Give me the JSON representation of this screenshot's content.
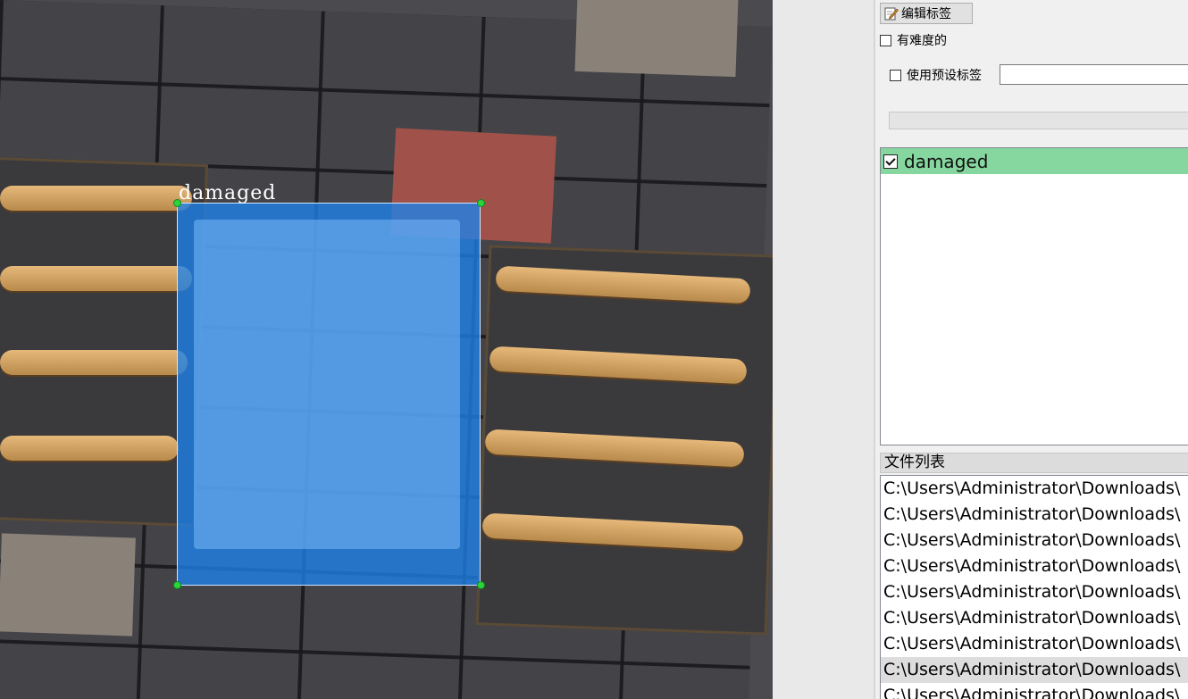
{
  "canvas": {
    "annotation": {
      "label": "damaged",
      "box_color": "#1e82eb",
      "vertex_color": "#2ad43a"
    }
  },
  "panel": {
    "edit_label_button": "编辑标签",
    "difficult_label": "有难度的",
    "difficult_checked": false,
    "use_default_label": "使用预设标签",
    "use_default_checked": false,
    "default_label_value": "",
    "labels": [
      {
        "text": "damaged",
        "checked": true,
        "color": "#86d79f"
      }
    ],
    "file_list_title": "文件列表",
    "files": [
      "C:\\Users\\Administrator\\Downloads\\",
      "C:\\Users\\Administrator\\Downloads\\",
      "C:\\Users\\Administrator\\Downloads\\",
      "C:\\Users\\Administrator\\Downloads\\",
      "C:\\Users\\Administrator\\Downloads\\",
      "C:\\Users\\Administrator\\Downloads\\",
      "C:\\Users\\Administrator\\Downloads\\",
      "C:\\Users\\Administrator\\Downloads\\",
      "C:\\Users\\Administrator\\Downloads\\"
    ],
    "selected_file_index": 7
  }
}
